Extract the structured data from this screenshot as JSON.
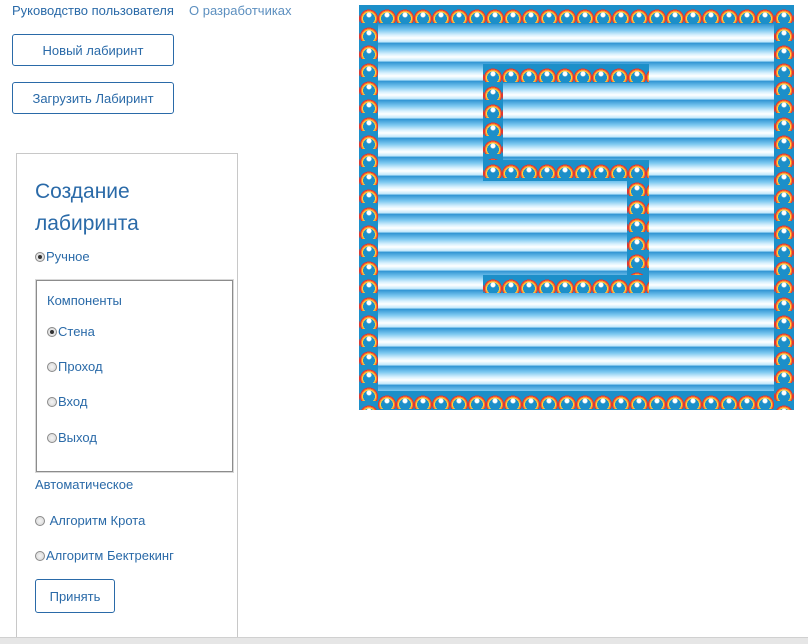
{
  "nav": {
    "user_guide": "Руководство пользователя",
    "about_devs": "О разработчиках"
  },
  "actions": {
    "new_maze": "Новый лабиринт",
    "load_maze": "Загрузить Лабиринт"
  },
  "panel": {
    "title": "Создание лабиринта",
    "manual": {
      "label": "Ручное",
      "checked": true
    },
    "components": {
      "label": "Компоненты",
      "items": [
        {
          "label": "Стена",
          "checked": true
        },
        {
          "label": "Проход",
          "checked": false
        },
        {
          "label": "Вход",
          "checked": false
        },
        {
          "label": "Выход",
          "checked": false
        }
      ]
    },
    "automatic": {
      "label": "Автоматическое",
      "items": [
        {
          "label": " Алгоритм Крота",
          "checked": false
        },
        {
          "label": "Алгоритм Бектрекинг",
          "checked": false
        }
      ]
    },
    "accept": "Принять"
  },
  "maze": {
    "wall_icon": "rainbow-cloud-tile",
    "path_style": "sky-gradient-stripes",
    "colors": {
      "wall": "#1c8fc9",
      "path_light": "#ffffff",
      "path_dark": "#2f94d2"
    }
  }
}
